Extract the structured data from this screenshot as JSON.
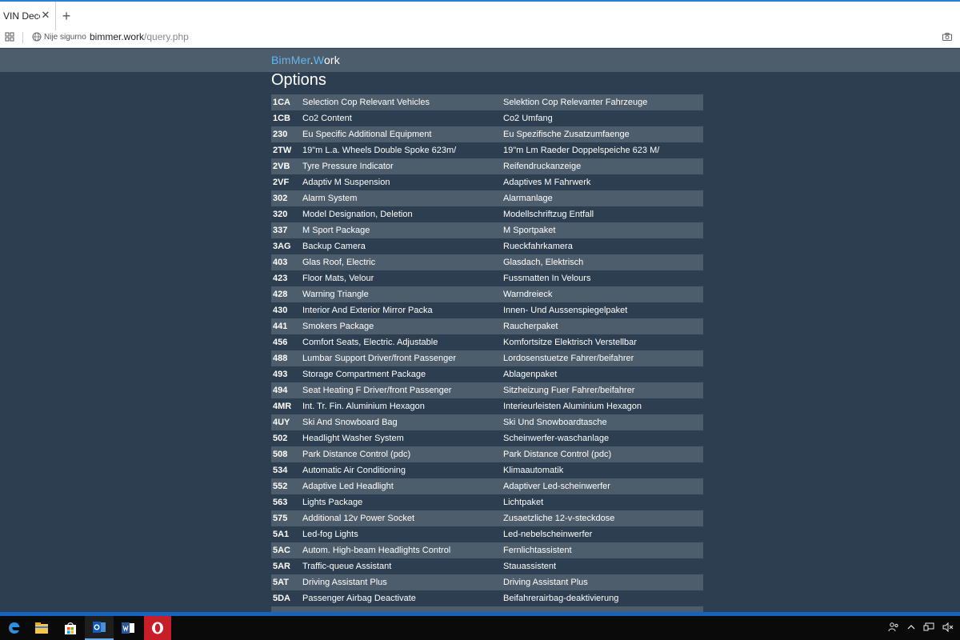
{
  "browser": {
    "tab_title": "VIN Decoder",
    "tab_close": "✕",
    "new_tab": "+",
    "security_label": "Nije sigurno",
    "url_host": "bimmer.work",
    "url_path": "/query.php"
  },
  "site": {
    "brand_part1": "Bim",
    "brand_part2": "Mer",
    "brand_part3": ".",
    "brand_part4": "W",
    "brand_part5": "ork",
    "page_title": "Options"
  },
  "options": [
    {
      "code": "1CA",
      "en": "Selection Cop Relevant Vehicles",
      "de": "Selektion Cop Relevanter Fahrzeuge"
    },
    {
      "code": "1CB",
      "en": "Co2 Content",
      "de": "Co2 Umfang"
    },
    {
      "code": "230",
      "en": "Eu Specific Additional Equipment",
      "de": "Eu Spezifische Zusatzumfaenge"
    },
    {
      "code": "2TW",
      "en": "19\"m L.a. Wheels Double Spoke 623m/",
      "de": "19\"m Lm Raeder Doppelspeiche 623 M/"
    },
    {
      "code": "2VB",
      "en": "Tyre Pressure Indicator",
      "de": "Reifendruckanzeige"
    },
    {
      "code": "2VF",
      "en": "Adaptiv M Suspension",
      "de": "Adaptives M Fahrwerk"
    },
    {
      "code": "302",
      "en": "Alarm System",
      "de": "Alarmanlage"
    },
    {
      "code": "320",
      "en": "Model Designation, Deletion",
      "de": "Modellschriftzug Entfall"
    },
    {
      "code": "337",
      "en": "M Sport Package",
      "de": "M Sportpaket"
    },
    {
      "code": "3AG",
      "en": "Backup Camera",
      "de": "Rueckfahrkamera"
    },
    {
      "code": "403",
      "en": "Glas Roof, Electric",
      "de": "Glasdach, Elektrisch"
    },
    {
      "code": "423",
      "en": "Floor Mats, Velour",
      "de": "Fussmatten In Velours"
    },
    {
      "code": "428",
      "en": "Warning Triangle",
      "de": "Warndreieck"
    },
    {
      "code": "430",
      "en": "Interior And Exterior Mirror Packa",
      "de": "Innen- Und Aussenspiegelpaket"
    },
    {
      "code": "441",
      "en": "Smokers Package",
      "de": "Raucherpaket"
    },
    {
      "code": "456",
      "en": "Comfort Seats, Electric. Adjustable",
      "de": "Komfortsitze Elektrisch Verstellbar"
    },
    {
      "code": "488",
      "en": "Lumbar Support Driver/front Passenger",
      "de": "Lordosenstuetze Fahrer/beifahrer"
    },
    {
      "code": "493",
      "en": "Storage Compartment Package",
      "de": "Ablagenpaket"
    },
    {
      "code": "494",
      "en": "Seat Heating F Driver/front Passenger",
      "de": "Sitzheizung Fuer Fahrer/beifahrer"
    },
    {
      "code": "4MR",
      "en": "Int. Tr. Fin. Aluminium Hexagon",
      "de": "Interieurleisten Aluminium Hexagon"
    },
    {
      "code": "4UY",
      "en": "Ski And Snowboard Bag",
      "de": "Ski Und Snowboardtasche"
    },
    {
      "code": "502",
      "en": "Headlight Washer System",
      "de": "Scheinwerfer-waschanlage"
    },
    {
      "code": "508",
      "en": "Park Distance Control (pdc)",
      "de": "Park Distance Control (pdc)"
    },
    {
      "code": "534",
      "en": "Automatic Air Conditioning",
      "de": "Klimaautomatik"
    },
    {
      "code": "552",
      "en": "Adaptive Led Headlight",
      "de": "Adaptiver Led-scheinwerfer"
    },
    {
      "code": "563",
      "en": "Lights Package",
      "de": "Lichtpaket"
    },
    {
      "code": "575",
      "en": "Additional 12v Power Socket",
      "de": "Zusaetzliche 12-v-steckdose"
    },
    {
      "code": "5A1",
      "en": "Led-fog Lights",
      "de": "Led-nebelscheinwerfer"
    },
    {
      "code": "5AC",
      "en": "Autom. High-beam Headlights Control",
      "de": "Fernlichtassistent"
    },
    {
      "code": "5AR",
      "en": "Traffic-queue Assistant",
      "de": "Stauassistent"
    },
    {
      "code": "5AT",
      "en": "Driving Assistant Plus",
      "de": "Driving Assistant Plus"
    },
    {
      "code": "5DA",
      "en": "Passenger Airbag Deactivate",
      "de": "Beifahrerairbag-deaktivierung"
    }
  ],
  "colors": {
    "page_bg": "#2c3e50",
    "header_bg": "#4e5d6c",
    "brand_accent": "#5fb8f2",
    "taskbar_accent": "#1565c0"
  },
  "taskbar": {
    "icons": [
      "edge-icon",
      "file-explorer-icon",
      "store-icon",
      "outlook-icon",
      "word-icon",
      "opera-icon"
    ]
  }
}
